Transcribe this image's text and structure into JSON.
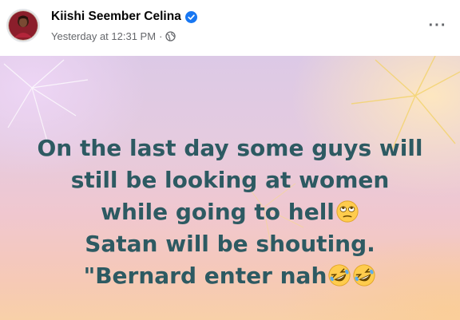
{
  "post": {
    "author": "Kiishi Seember Celina",
    "timestamp": "Yesterday at 12:31 PM",
    "separator": "·",
    "more_label": "···",
    "text_lines": [
      "On the last day some guys will",
      "still be looking at women",
      "while going to hell",
      "Satan will be shouting.",
      "\"Bernard enter nah"
    ],
    "icons": {
      "verified": "verified-badge-icon",
      "audience": "globe-icon",
      "eye_roll": "eye-roll-emoji",
      "laughing": "rolling-laughing-emoji"
    },
    "colors": {
      "text": "#2d5a62",
      "verified": "#1877f2",
      "meta": "#65676b"
    }
  }
}
